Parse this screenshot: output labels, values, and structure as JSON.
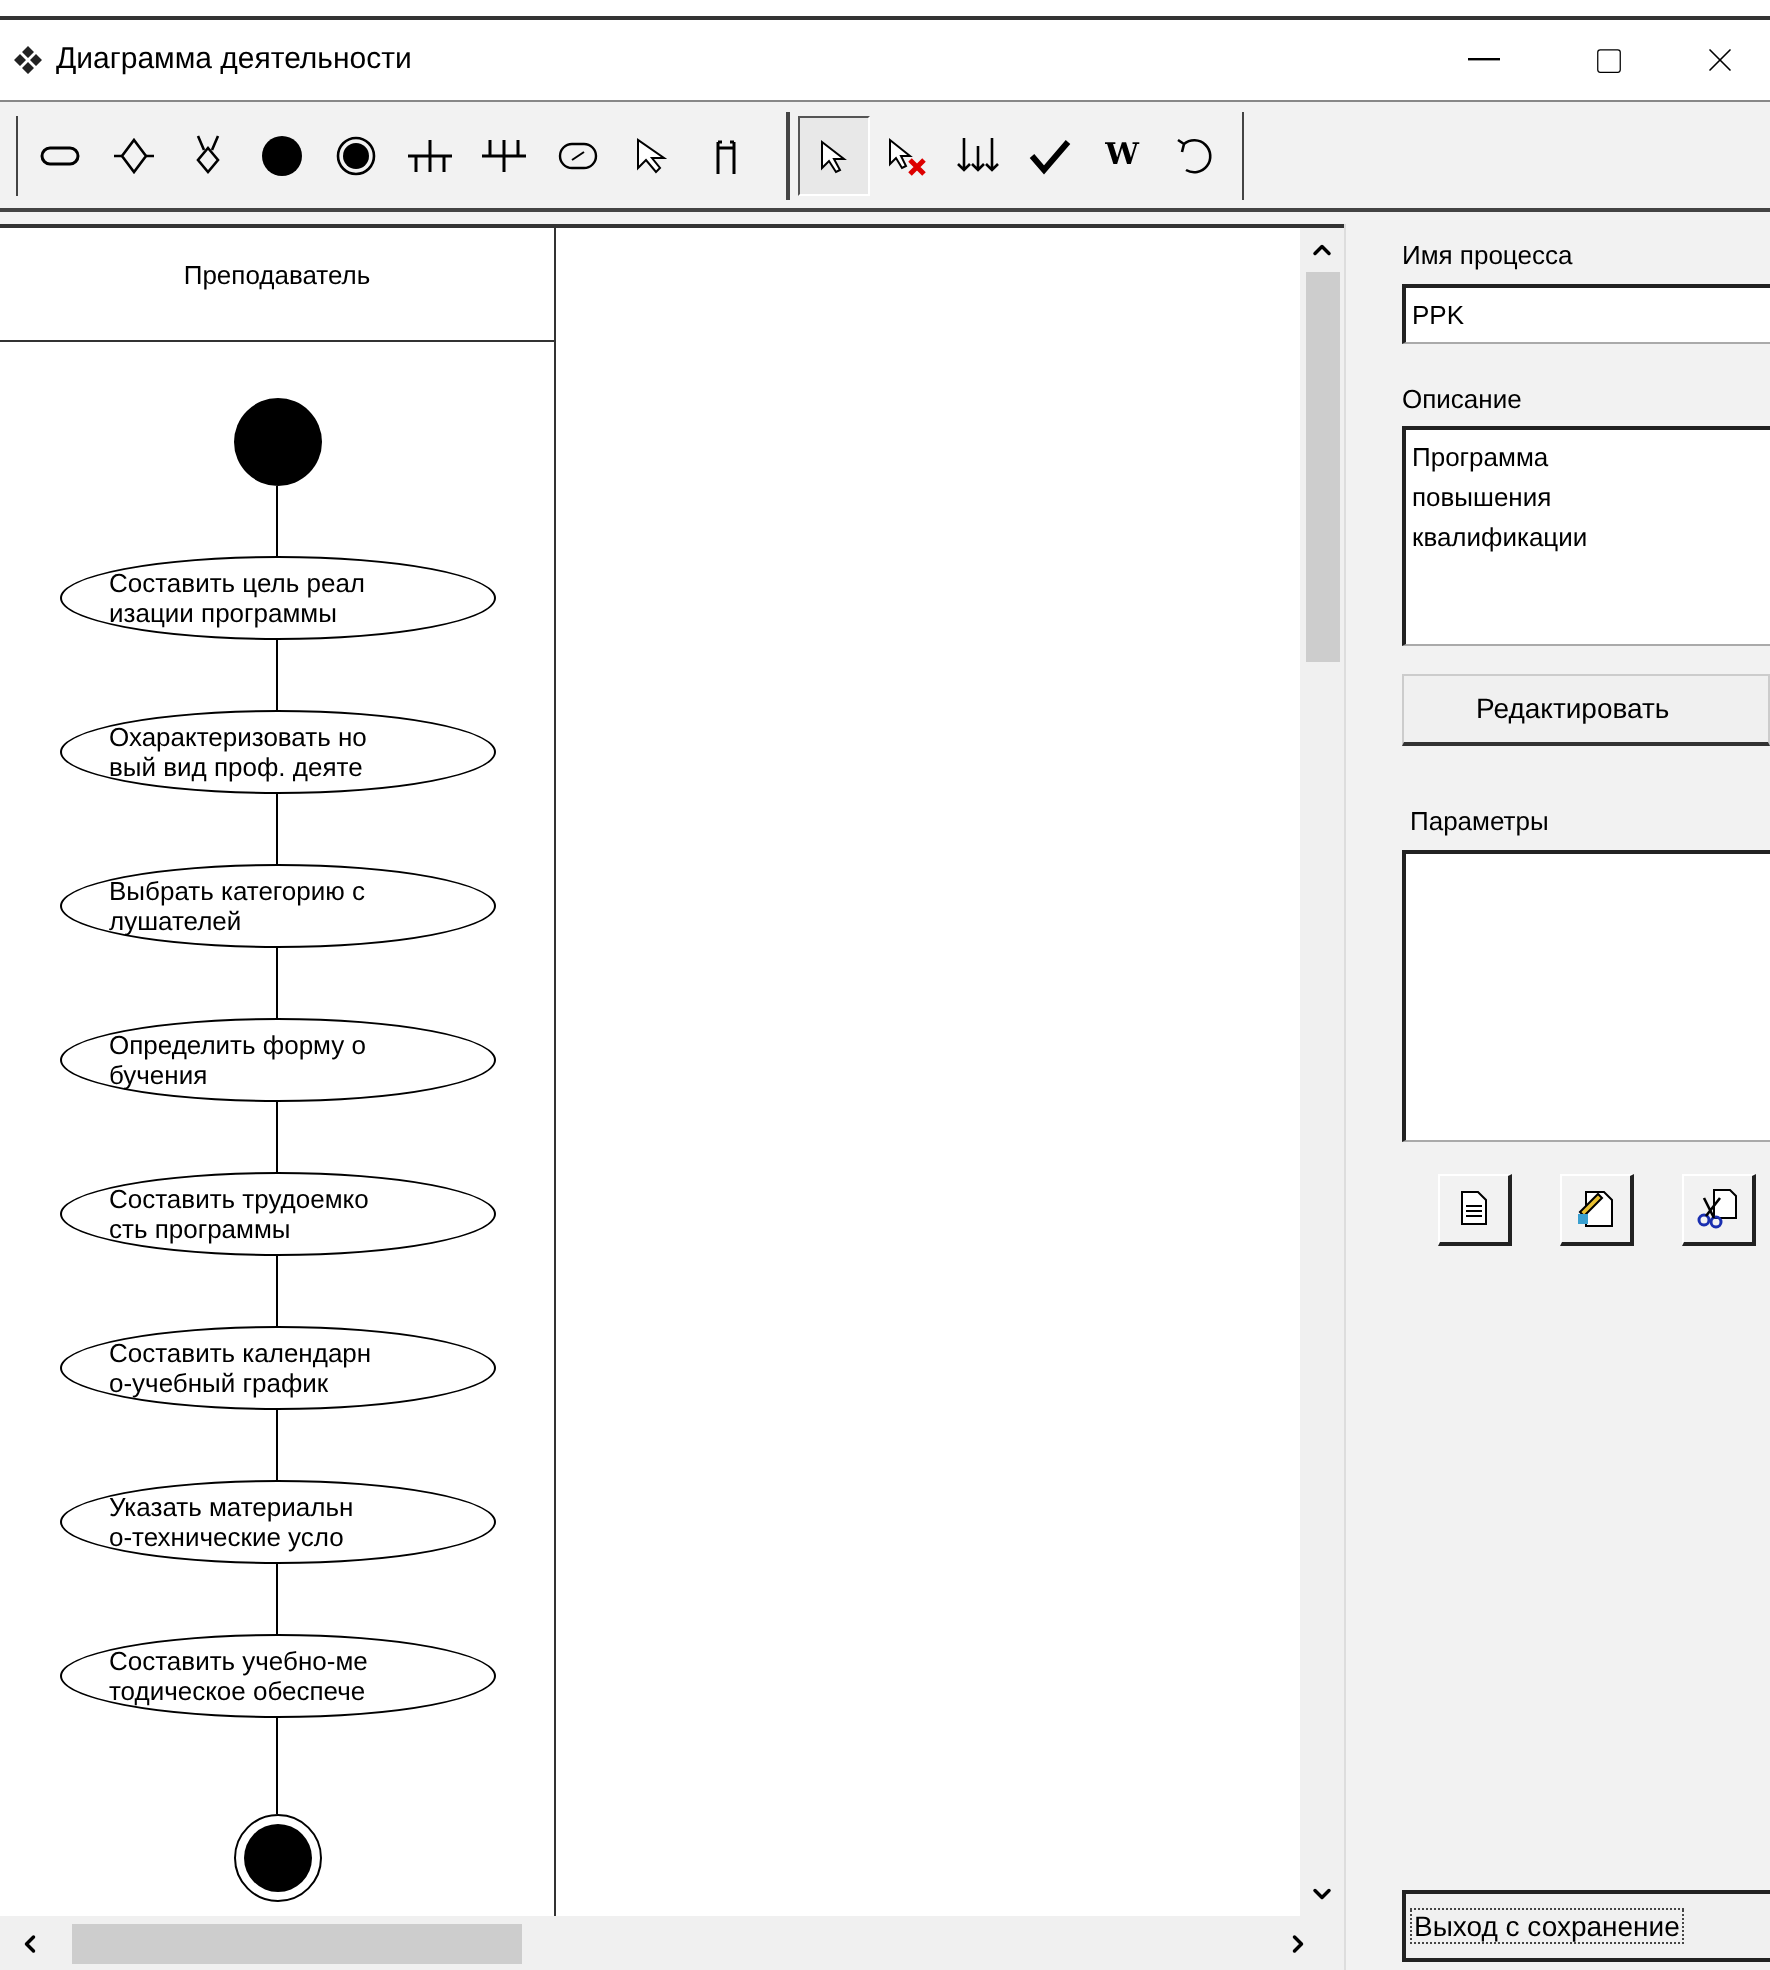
{
  "window": {
    "title": "Диаграмма деятельности"
  },
  "toolbar": {
    "groups": [
      [
        {
          "kind": "activity",
          "selected": false
        },
        {
          "kind": "decision",
          "selected": false
        },
        {
          "kind": "merge",
          "selected": false
        },
        {
          "kind": "start",
          "selected": false
        },
        {
          "kind": "end",
          "selected": false
        },
        {
          "kind": "fork",
          "selected": false
        },
        {
          "kind": "join",
          "selected": false
        },
        {
          "kind": "object",
          "selected": false
        },
        {
          "kind": "transition",
          "selected": false
        },
        {
          "kind": "swimlane",
          "selected": false
        }
      ],
      [
        {
          "kind": "pointer",
          "selected": true
        },
        {
          "kind": "delete",
          "selected": false
        },
        {
          "kind": "arrange",
          "selected": false
        },
        {
          "kind": "check",
          "selected": false
        },
        {
          "kind": "word",
          "selected": false,
          "glyph": "W"
        },
        {
          "kind": "undo",
          "selected": false
        }
      ]
    ]
  },
  "diagram": {
    "lane": "Преподаватель",
    "activities": [
      {
        "lines": [
          "Составить цель реал",
          "изации программы"
        ]
      },
      {
        "lines": [
          "Охарактеризовать но",
          "вый вид проф. деяте"
        ]
      },
      {
        "lines": [
          "Выбрать категорию с",
          "лушателей"
        ]
      },
      {
        "lines": [
          "Определить форму о",
          "бучения"
        ]
      },
      {
        "lines": [
          "Составить трудоемко",
          "сть программы"
        ]
      },
      {
        "lines": [
          "Составить календарн",
          "о-учебный график"
        ]
      },
      {
        "lines": [
          "Указать материальн",
          "о-технические усло"
        ]
      },
      {
        "lines": [
          "Составить учебно-ме",
          "тодическое обеспече"
        ]
      }
    ]
  },
  "panel": {
    "name_label": "Имя процесса",
    "name_value": "PPK",
    "description_label": "Описание",
    "description_value": "Программа\nповышения\nквалификации",
    "edit_button": "Редактировать",
    "params_label": "Параметры",
    "exit_button": "Выход с сохранение"
  }
}
